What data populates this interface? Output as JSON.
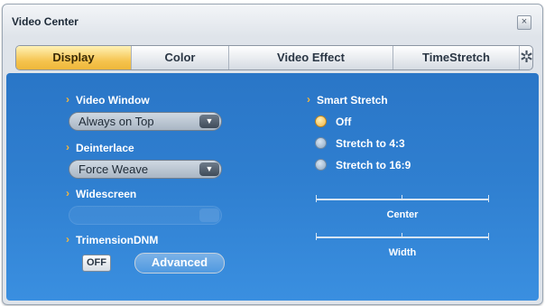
{
  "window": {
    "title": "Video Center",
    "close_glyph": "×"
  },
  "tabs": [
    {
      "label": "Display",
      "active": true
    },
    {
      "label": "Color",
      "active": false
    },
    {
      "label": "Video Effect",
      "active": false
    },
    {
      "label": "TimeStretch",
      "active": false
    }
  ],
  "settings_icon": {
    "name": "gear-icon",
    "glyph": "✲"
  },
  "display": {
    "video_window": {
      "label": "Video Window",
      "value": "Always on Top"
    },
    "deinterlace": {
      "label": "Deinterlace",
      "value": "Force Weave"
    },
    "widescreen": {
      "label": "Widescreen",
      "value": ""
    },
    "trimension": {
      "label": "TrimensionDNM",
      "toggle": "OFF",
      "advanced": "Advanced"
    },
    "smart_stretch": {
      "label": "Smart Stretch",
      "options": [
        {
          "label": "Off",
          "selected": true
        },
        {
          "label": "Stretch to 4:3",
          "selected": false
        },
        {
          "label": "Stretch to 16:9",
          "selected": false
        }
      ]
    },
    "sliders": {
      "center": {
        "label": "Center"
      },
      "width": {
        "label": "Width"
      }
    }
  },
  "colors": {
    "accent": "#f4b63c",
    "panel": "#2f7fd0",
    "active_tab": "#f5c34d"
  }
}
